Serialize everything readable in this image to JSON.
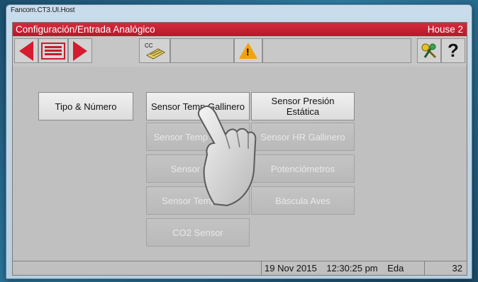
{
  "window": {
    "title": "Fancom.CT3.UI.Host"
  },
  "header": {
    "title": "Configuración/Entrada Analógico",
    "house": "House 2"
  },
  "toolbar": {
    "prev_icon": "left-arrow-icon",
    "list_icon": "list-icon",
    "next_icon": "right-arrow-icon",
    "cc_label": "CC",
    "warning_symbol": "!",
    "keys_icon": "keys-icon",
    "help_label": "?"
  },
  "buttons": {
    "tipo_numero": "Tipo & Número",
    "sensor_temp_gallinero": "Sensor Temp Gallinero",
    "sensor_presion_estatica": "Sensor Presión Estática",
    "sensor_temp_exterior": "Sensor Temp Exterior",
    "sensor_hr_gallinero": "Sensor HR Gallinero",
    "sensor_temp_x": "Sensor Temp",
    "potenciometros": "Potenciómetros",
    "sensor_temp_aux": "Sensor Temp Aux",
    "bascula_aves": "Báscula Aves",
    "co2_sensor": "CO2 Sensor"
  },
  "status": {
    "date": "19 Nov 2015",
    "time": "12:30:25 pm",
    "label": "Eda",
    "number": "32"
  },
  "colors": {
    "accent_red": "#c41e30",
    "warning": "#f2a20c"
  }
}
